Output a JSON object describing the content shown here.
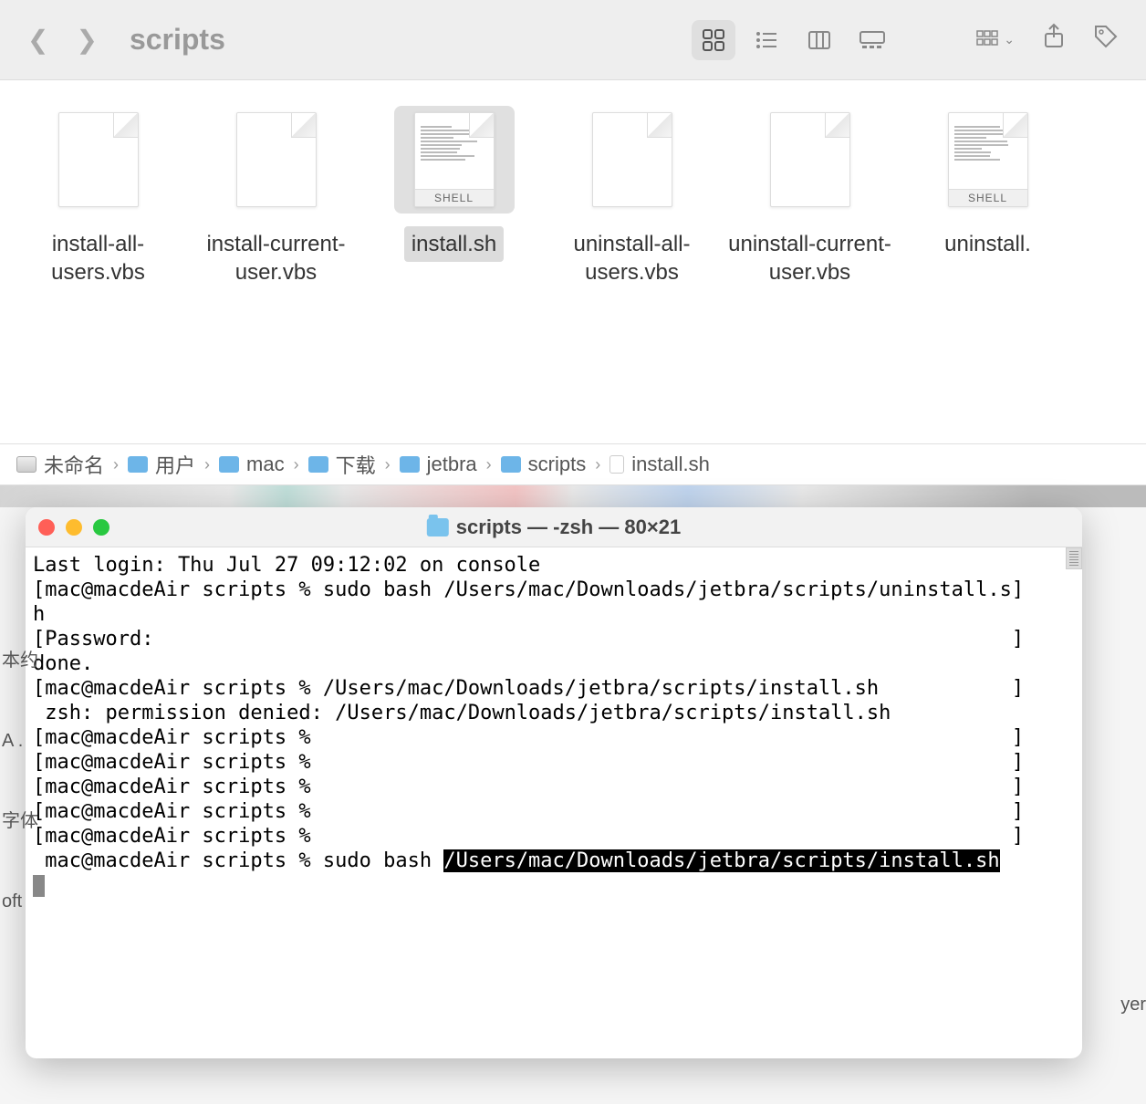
{
  "finder": {
    "title": "scripts",
    "files": [
      {
        "name": "install-all-users.vbs",
        "type": "vbs",
        "selected": false
      },
      {
        "name": "install-current-user.vbs",
        "type": "vbs",
        "selected": false
      },
      {
        "name": "install.sh",
        "type": "shell",
        "selected": true
      },
      {
        "name": "uninstall-all-users.vbs",
        "type": "vbs",
        "selected": false
      },
      {
        "name": "uninstall-current-user.vbs",
        "type": "vbs",
        "selected": false
      },
      {
        "name": "uninstall.",
        "type": "shell",
        "selected": false
      }
    ],
    "shell_badge": "SHELL",
    "breadcrumb": [
      {
        "label": "未命名",
        "icon": "disk"
      },
      {
        "label": "用户",
        "icon": "folder"
      },
      {
        "label": "mac",
        "icon": "folder"
      },
      {
        "label": "下载",
        "icon": "folder"
      },
      {
        "label": "jetbra",
        "icon": "folder"
      },
      {
        "label": "scripts",
        "icon": "folder"
      },
      {
        "label": "install.sh",
        "icon": "file"
      }
    ]
  },
  "terminal": {
    "title": "scripts — -zsh — 80×21",
    "lines": [
      "Last login: Thu Jul 27 09:12:02 on console",
      "[mac@macdeAir scripts % sudo bash /Users/mac/Downloads/jetbra/scripts/uninstall.s]",
      "h",
      "[Password:                                                                       ]",
      "done.",
      "[mac@macdeAir scripts % /Users/mac/Downloads/jetbra/scripts/install.sh           ]",
      " zsh: permission denied: /Users/mac/Downloads/jetbra/scripts/install.sh",
      "[mac@macdeAir scripts %                                                          ]",
      "[mac@macdeAir scripts %                                                          ]",
      "[mac@macdeAir scripts %                                                          ]",
      "[mac@macdeAir scripts %                                                          ]",
      "[mac@macdeAir scripts %                                                          ]"
    ],
    "last_prompt": " mac@macdeAir scripts % sudo bash ",
    "highlighted_path": "/Users/mac/Downloads/jetbra/scripts/install.sh"
  },
  "edge": {
    "left_items": [
      "本约",
      "A .",
      "字体",
      "oft"
    ],
    "right_item": "yer"
  }
}
